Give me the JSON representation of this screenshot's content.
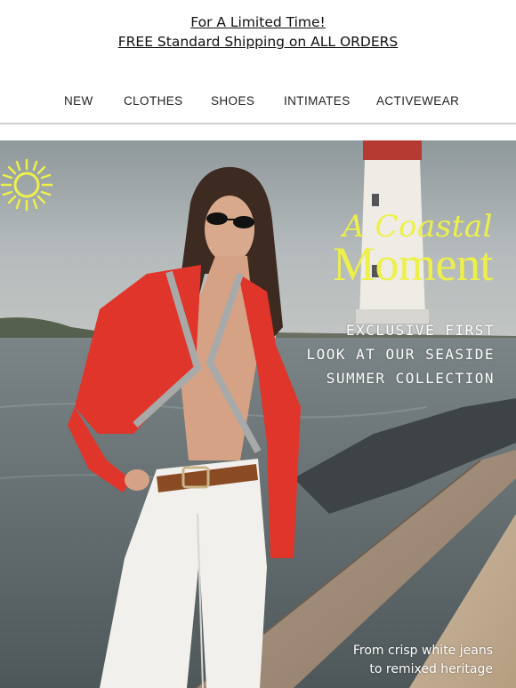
{
  "promo": {
    "line1": "For A Limited Time!",
    "line2": "FREE Standard Shipping on ALL ORDERS"
  },
  "nav": {
    "items": [
      {
        "label": "NEW"
      },
      {
        "label": "CLOTHES"
      },
      {
        "label": "SHOES"
      },
      {
        "label": "INTIMATES"
      },
      {
        "label": "ACTIVEWEAR"
      }
    ]
  },
  "hero": {
    "title_script": "A Coastal",
    "title_main": "Moment",
    "subtitle_lines": [
      "EXCLUSIVE FIRST",
      "LOOK AT OUR SEASIDE",
      "SUMMER COLLECTION"
    ],
    "caption_lines": [
      "From crisp white jeans",
      "to remixed heritage"
    ],
    "colors": {
      "accent_yellow": "#eef04a",
      "cardigan_red": "#e0352b",
      "sky": "#9aa3a5",
      "sea": "#5e676a"
    }
  }
}
